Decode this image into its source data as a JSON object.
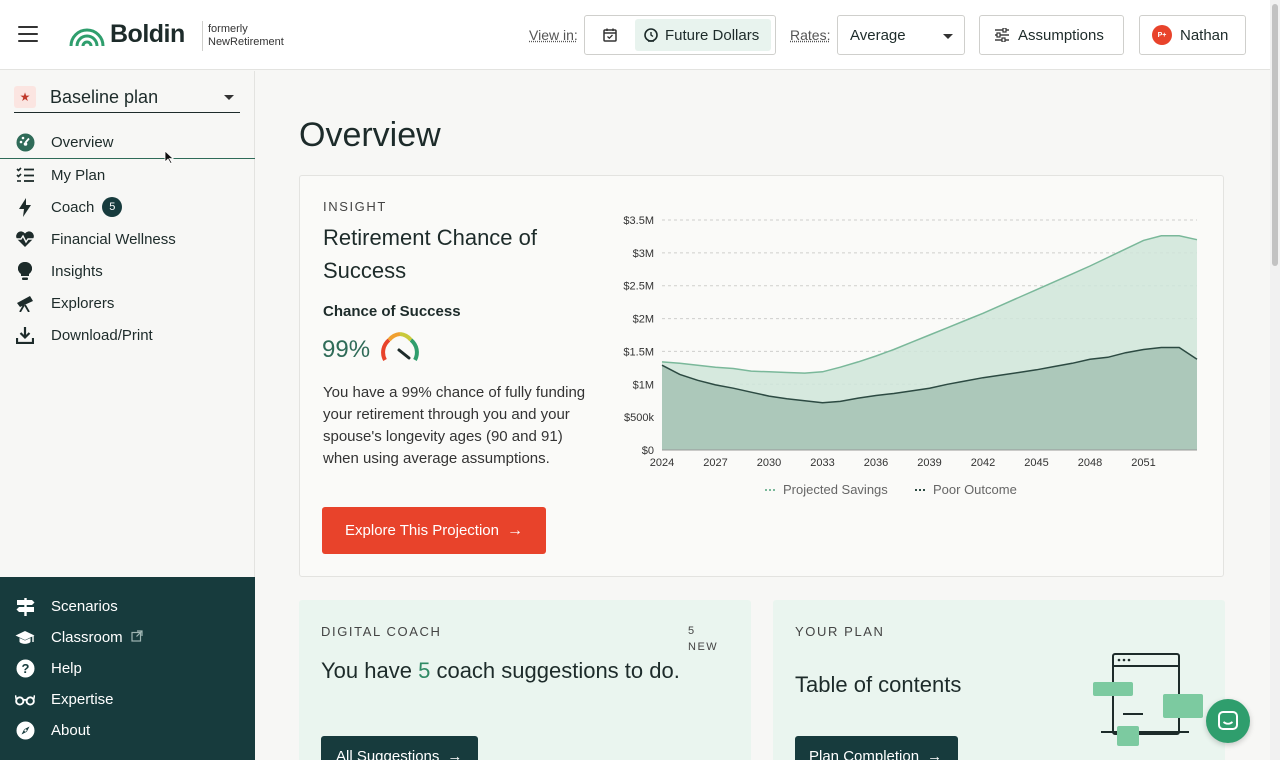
{
  "header": {
    "logo_text": "Boldin",
    "formerly_line1": "formerly",
    "formerly_line2": "NewRetirement",
    "view_in_label": "View in:",
    "dollars_toggle": "Future Dollars",
    "rates_label": "Rates:",
    "rates_value": "Average",
    "assumptions_label": "Assumptions",
    "user_initials": "P+",
    "user_name": "Nathan"
  },
  "sidebar": {
    "plan_name": "Baseline plan",
    "items": [
      {
        "label": "Overview",
        "icon": "dashboard-icon"
      },
      {
        "label": "My Plan",
        "icon": "checklist-icon"
      },
      {
        "label": "Coach",
        "icon": "lightning-icon",
        "badge": "5"
      },
      {
        "label": "Financial Wellness",
        "icon": "heartbeat-icon"
      },
      {
        "label": "Insights",
        "icon": "lightbulb-icon"
      },
      {
        "label": "Explorers",
        "icon": "telescope-icon"
      },
      {
        "label": "Download/Print",
        "icon": "download-icon"
      }
    ],
    "bottom_items": [
      {
        "label": "Scenarios",
        "icon": "signpost-icon"
      },
      {
        "label": "Classroom",
        "icon": "graduation-cap-icon",
        "external": true
      },
      {
        "label": "Help",
        "icon": "question-icon"
      },
      {
        "label": "Expertise",
        "icon": "glasses-icon"
      },
      {
        "label": "About",
        "icon": "compass-icon"
      }
    ]
  },
  "main": {
    "page_title": "Overview",
    "insight": {
      "eyebrow": "INSIGHT",
      "title": "Retirement Chance of Success",
      "cos_label": "Chance of Success",
      "cos_value": "99%",
      "description": "You have a 99% chance of fully funding your retirement through you and your spouse's longevity ages (90 and 91) when using average assumptions.",
      "button_label": "Explore This Projection"
    },
    "coach": {
      "eyebrow": "DIGITAL COACH",
      "new_count": "5",
      "new_label": "NEW",
      "title_prefix": "You have",
      "title_number": "5",
      "title_suffix": "coach suggestions to do.",
      "button_label": "All Suggestions"
    },
    "plan": {
      "eyebrow": "YOUR PLAN",
      "title": "Table of contents",
      "button_label": "Plan Completion"
    }
  },
  "colors": {
    "accent_red": "#e8432b",
    "dark_teal": "#173b3d",
    "green": "#2f6b58",
    "light_green_bg": "#eaf5ef"
  },
  "chart_data": {
    "type": "area",
    "x": [
      2024,
      2025,
      2026,
      2027,
      2028,
      2029,
      2030,
      2031,
      2032,
      2033,
      2034,
      2035,
      2036,
      2037,
      2038,
      2039,
      2040,
      2041,
      2042,
      2043,
      2044,
      2045,
      2046,
      2047,
      2048,
      2049,
      2050,
      2051,
      2052,
      2053,
      2054
    ],
    "xticks": [
      2024,
      2027,
      2030,
      2033,
      2036,
      2039,
      2042,
      2045,
      2048,
      2051
    ],
    "yticks": [
      "$0",
      "$500k",
      "$1M",
      "$1.5M",
      "$2M",
      "$2.5M",
      "$3M",
      "$3.5M"
    ],
    "ylim": [
      0,
      3500000
    ],
    "series": [
      {
        "name": "Projected Savings",
        "color": "#cfe5d9",
        "values": [
          1340000,
          1320000,
          1290000,
          1260000,
          1240000,
          1200000,
          1190000,
          1180000,
          1170000,
          1190000,
          1260000,
          1340000,
          1430000,
          1530000,
          1640000,
          1750000,
          1860000,
          1970000,
          2080000,
          2200000,
          2320000,
          2440000,
          2560000,
          2680000,
          2800000,
          2930000,
          3060000,
          3190000,
          3260000,
          3260000,
          3200000
        ]
      },
      {
        "name": "Poor Outcome",
        "color": "#a7c4b6",
        "values": [
          1290000,
          1150000,
          1060000,
          990000,
          940000,
          880000,
          820000,
          780000,
          750000,
          720000,
          740000,
          790000,
          830000,
          860000,
          900000,
          940000,
          1000000,
          1050000,
          1100000,
          1140000,
          1180000,
          1220000,
          1270000,
          1320000,
          1380000,
          1410000,
          1480000,
          1530000,
          1560000,
          1560000,
          1380000
        ]
      }
    ],
    "legend": [
      "Projected Savings",
      "Poor Outcome"
    ],
    "grid": true
  }
}
